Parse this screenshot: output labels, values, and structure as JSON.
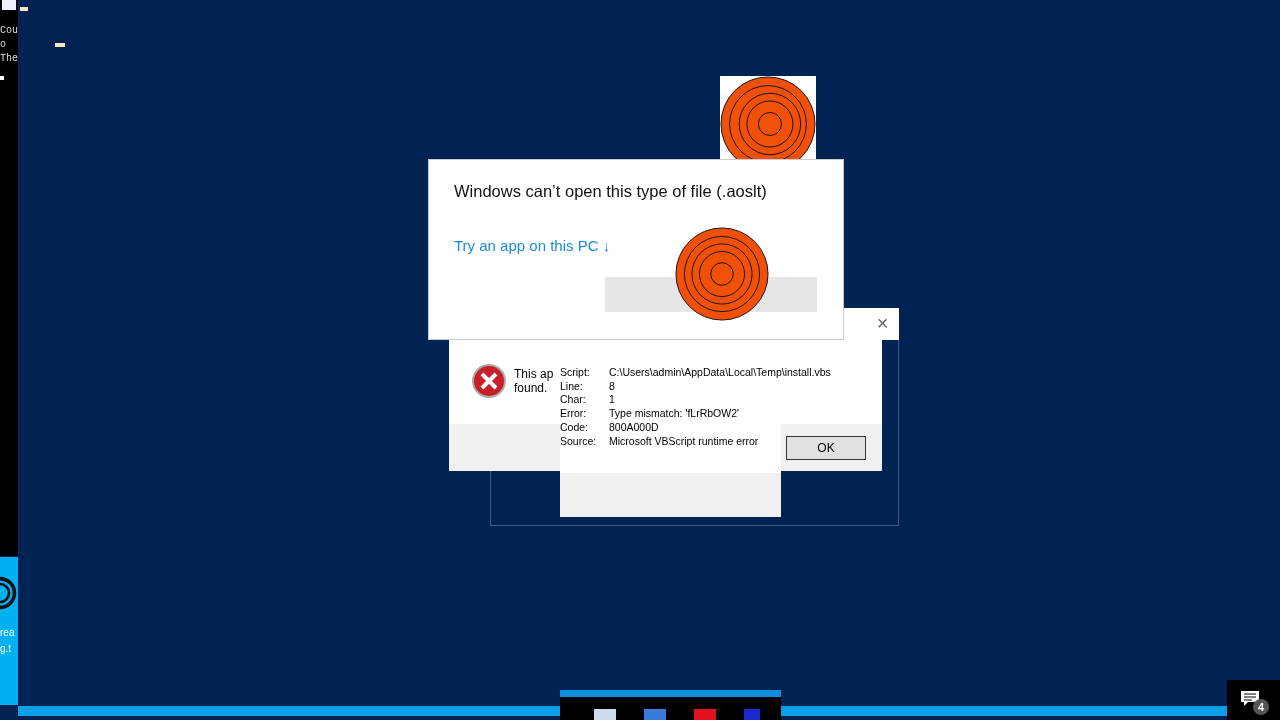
{
  "terminal": {
    "lines": [
      "Cou",
      "o",
      "The"
    ]
  },
  "side_panel": {
    "lines": [
      "rea",
      "g.t"
    ]
  },
  "open_with_dialog": {
    "title": "Windows can’t open this type of file (.aoslt)",
    "link": "Try an app on this PC ↓"
  },
  "error_dialog": {
    "message_lines": [
      "This ap",
      "found."
    ],
    "close": "×"
  },
  "script_error": {
    "fields": [
      {
        "label": "Script:",
        "value": "C:\\Users\\admin\\AppData\\Local\\Temp\\install.vbs"
      },
      {
        "label": "Line:",
        "value": "8"
      },
      {
        "label": "Char:",
        "value": "1"
      },
      {
        "label": "Error:",
        "value": "Type mismatch: 'fLrRbOW2'"
      },
      {
        "label": "Code:",
        "value": "800A000D"
      },
      {
        "label": "Source:",
        "value": "Microsoft VBScript runtime error"
      }
    ],
    "button": "OK"
  },
  "notification_count": "4"
}
